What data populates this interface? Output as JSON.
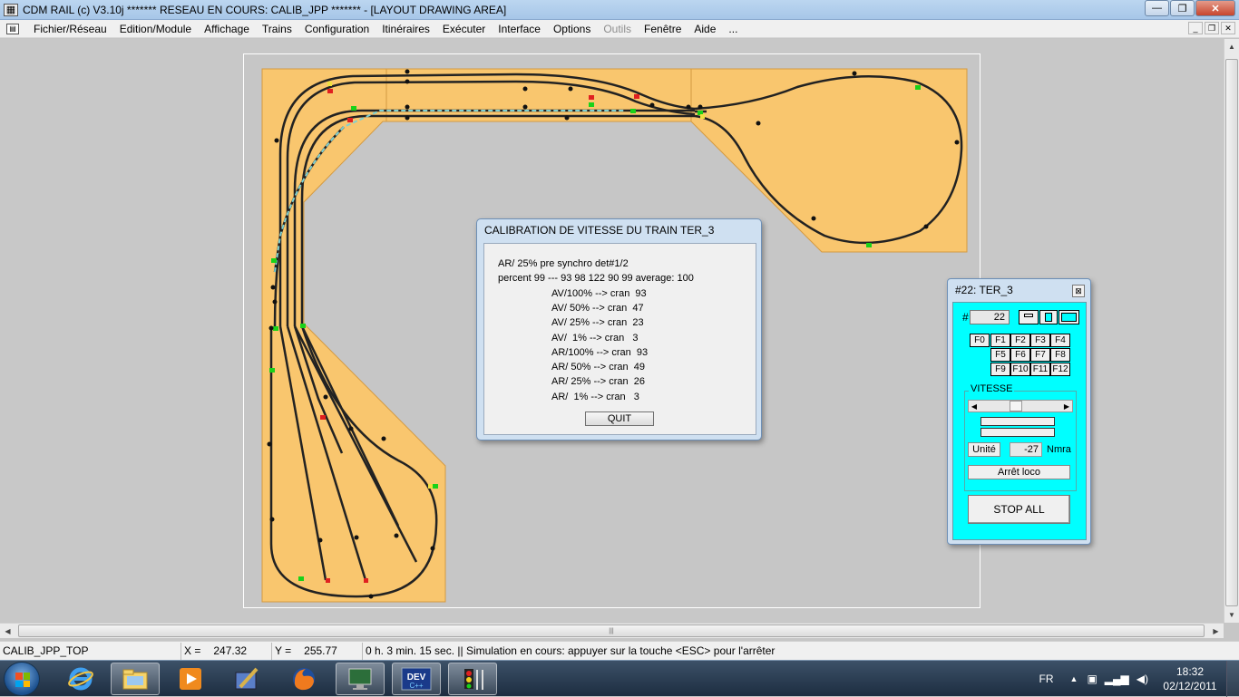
{
  "window": {
    "title": "CDM RAIL (c) V3.10j     ******* RESEAU EN COURS: CALIB_JPP ******* - [LAYOUT DRAWING AREA]",
    "minimize": "—",
    "maximize": "❐",
    "close": "✕"
  },
  "menu": {
    "items": [
      {
        "label": "Fichier/Réseau"
      },
      {
        "label": "Edition/Module"
      },
      {
        "label": "Affichage"
      },
      {
        "label": "Trains"
      },
      {
        "label": "Configuration"
      },
      {
        "label": "Itinéraires"
      },
      {
        "label": "Exécuter"
      },
      {
        "label": "Interface"
      },
      {
        "label": "Options"
      },
      {
        "label": "Outils"
      },
      {
        "label": "Fenêtre"
      },
      {
        "label": "Aide"
      },
      {
        "label": "..."
      }
    ],
    "mdi_minimize": "_",
    "mdi_restore": "❐",
    "mdi_close": "✕"
  },
  "colors": {
    "board": "#f9c66e",
    "track": "#222222",
    "signal_green": "#19d219",
    "signal_red": "#e02020",
    "route": "#7fd1d1",
    "cab_bg": "#00ffff"
  },
  "calibration": {
    "title": "CALIBRATION DE VITESSE DU TRAIN TER_3",
    "line1": "AR/ 25% pre synchro det#1/2",
    "line2": "percent 99 --- 93 98 122 90 99 average: 100",
    "results": [
      "AV/100% --> cran  93",
      "AV/ 50% --> cran  47",
      "AV/ 25% --> cran  23",
      "AV/  1% --> cran   3",
      "AR/100% --> cran  93",
      "AR/ 50% --> cran  49",
      "AR/ 25% --> cran  26",
      "AR/  1% --> cran   3"
    ],
    "quit": "QUIT"
  },
  "cab": {
    "title": "#22: TER_3",
    "close": "⊠",
    "hash": "#",
    "address": "22",
    "functions": [
      "F0",
      "F1",
      "F2",
      "F3",
      "F4",
      "F5",
      "F6",
      "F7",
      "F8",
      "F9",
      "F10",
      "F11",
      "F12"
    ],
    "vitesse_label": "VITESSE",
    "slider_value": 0.42,
    "unite": "Unité",
    "speed_value": "-27",
    "unit_name": "Nmra",
    "arret": "Arrêt loco",
    "stop_all": "STOP ALL"
  },
  "status": {
    "layout_name": "CALIB_JPP_TOP",
    "x_label": "X =",
    "x_value": "247.32",
    "y_label": "Y =",
    "y_value": "255.77",
    "message": "0 h. 3 min. 15 sec.  || Simulation en cours: appuyer sur la touche <ESC> pour l'arrêter"
  },
  "taskbar": {
    "lang": "FR",
    "time": "18:32",
    "date": "02/12/2011",
    "apps": [
      "start-button",
      "internet-explorer-icon",
      "file-explorer-icon",
      "media-player-icon",
      "paint-brush-icon",
      "firefox-icon",
      "monitor-app-icon",
      "dev-cpp-icon",
      "cdm-rail-icon"
    ]
  }
}
